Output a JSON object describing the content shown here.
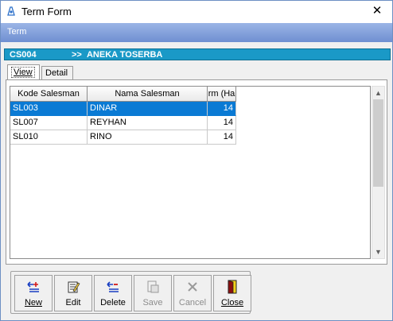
{
  "window": {
    "title": "Term Form",
    "close_glyph": "✕"
  },
  "header": {
    "section_label": "Term"
  },
  "customer": {
    "code": "CS004",
    "separator": ">>",
    "name": "ANEKA TOSERBA"
  },
  "tabs": [
    {
      "label": "View",
      "active": true
    },
    {
      "label": "Detail",
      "active": false
    }
  ],
  "grid": {
    "columns": [
      "Kode Salesman",
      "Nama Salesman",
      "rm (Ha"
    ],
    "rows": [
      {
        "kode": "SL003",
        "nama": "DINAR",
        "term": "14",
        "selected": true
      },
      {
        "kode": "SL007",
        "nama": "REYHAN",
        "term": "14",
        "selected": false
      },
      {
        "kode": "SL010",
        "nama": "RINO",
        "term": "14",
        "selected": false
      }
    ]
  },
  "toolbar": {
    "new_label": "New",
    "edit_label": "Edit",
    "delete_label": "Delete",
    "save_label": "Save",
    "cancel_label": "Cancel",
    "close_label": "Close"
  },
  "colors": {
    "selection": "#0a7ad4",
    "customer_bar": "#1a99c7",
    "header_bar": "#7f9bd8"
  }
}
